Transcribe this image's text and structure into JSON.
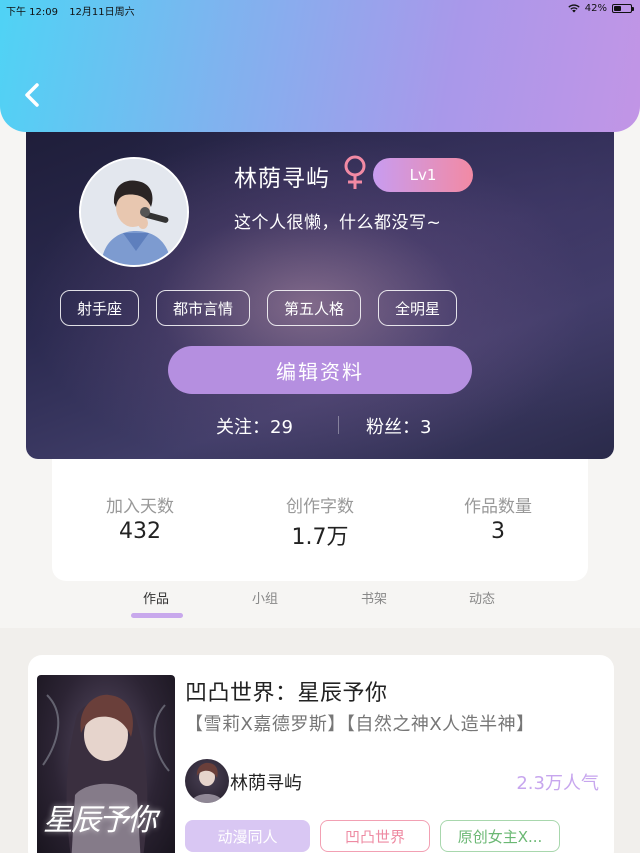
{
  "status_bar": {
    "time": "下午 12:09",
    "date": "12月11日周六",
    "battery": "42%",
    "battery_level": 0.42
  },
  "profile": {
    "username": "林荫寻屿",
    "level": "Lv1",
    "bio": "这个人很懒，什么都没写~",
    "tags": [
      "射手座",
      "都市言情",
      "第五人格",
      "全明星"
    ],
    "edit_button": "编辑资料",
    "following": "关注：29",
    "followers": "粉丝：3",
    "colors": {
      "level_start": "#c89cf0",
      "level_end": "#f28aa4",
      "gender": "#f28aa4",
      "edit": "#b58fe0"
    }
  },
  "stats": [
    {
      "label": "加入天数",
      "value": "432"
    },
    {
      "label": "创作字数",
      "value": "1.7万"
    },
    {
      "label": "作品数量",
      "value": "3"
    }
  ],
  "tabs": [
    {
      "label": "作品",
      "active": true
    },
    {
      "label": "小组",
      "active": false
    },
    {
      "label": "书架",
      "active": false
    },
    {
      "label": "动态",
      "active": false
    }
  ],
  "work": {
    "title": "凹凸世界：星辰予你",
    "description": "【雪莉X嘉德罗斯】【自然之神X人造半神】",
    "cover_text": "星辰予你",
    "author": "林荫寻屿",
    "popularity": "2.3万人气",
    "tags": [
      "动漫同人",
      "凹凸世界",
      "原创女主X..."
    ]
  }
}
